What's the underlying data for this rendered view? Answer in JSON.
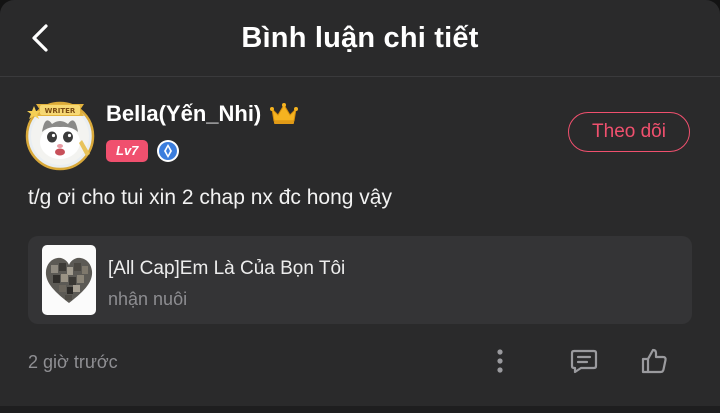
{
  "header": {
    "title": "Bình luận chi tiết",
    "back_icon": "chevron-left-icon"
  },
  "comment": {
    "author": {
      "name": "Bella(Yến_Nhi)",
      "avatar_badge": "WRITER",
      "level": "Lv7",
      "crown_icon": "crown-icon",
      "verified_icon": "verified-badge-icon"
    },
    "follow_label": "Theo dõi",
    "text": "t/g ơi cho tui xin 2 chap nx đc hong vậy",
    "story": {
      "title": "[All Cap]Em Là Của Bọn Tôi",
      "subtitle": "nhận nuôi"
    },
    "time": "2 giờ trước",
    "actions": [
      "more-vertical-icon",
      "reply-comment-icon",
      "like-thumb-icon"
    ]
  },
  "colors": {
    "accent": "#f0506e",
    "background": "#2a2a2b",
    "card": "#343436",
    "muted_text": "#8f8f93",
    "verified": "#3b7ddd"
  }
}
